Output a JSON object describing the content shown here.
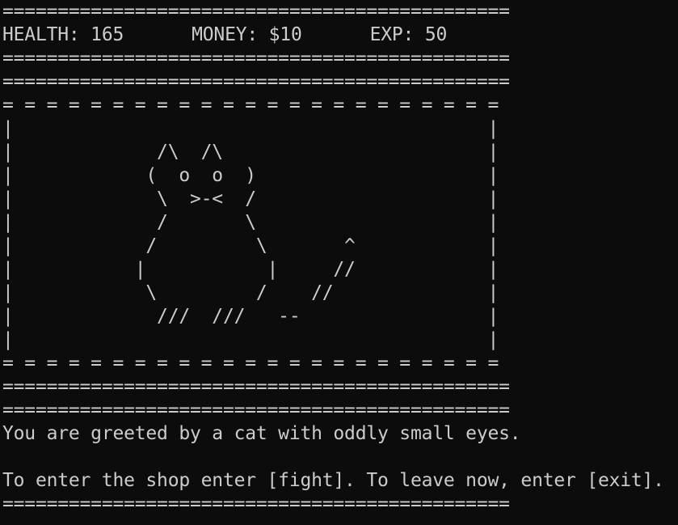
{
  "separator": "==============================================",
  "stats": {
    "health_label": "HEALTH: 165",
    "money_label": "MONEY: $10",
    "exp_label": "EXP: 50"
  },
  "art_border_top": "= = = = = = = = = = = = = = = = = = = = = = =",
  "art_lines": [
    "|                                           |",
    "|             /\\  /\\                        |",
    "|            (  o  o  )                     |",
    "|             \\  >-<  /                     |",
    "|             /       \\                     |",
    "|            /         \\       ^            |",
    "|           |           |     //            |",
    "|            \\         /    //              |",
    "|             ///  ///   --                 |",
    "|                                           |"
  ],
  "art_border_bottom": "= = = = = = = = = = = = = = = = = = = = = = =",
  "message": "You are greeted by a cat with oddly small eyes.",
  "prompt": "To enter the shop enter [fight]. To leave now, enter [exit]."
}
